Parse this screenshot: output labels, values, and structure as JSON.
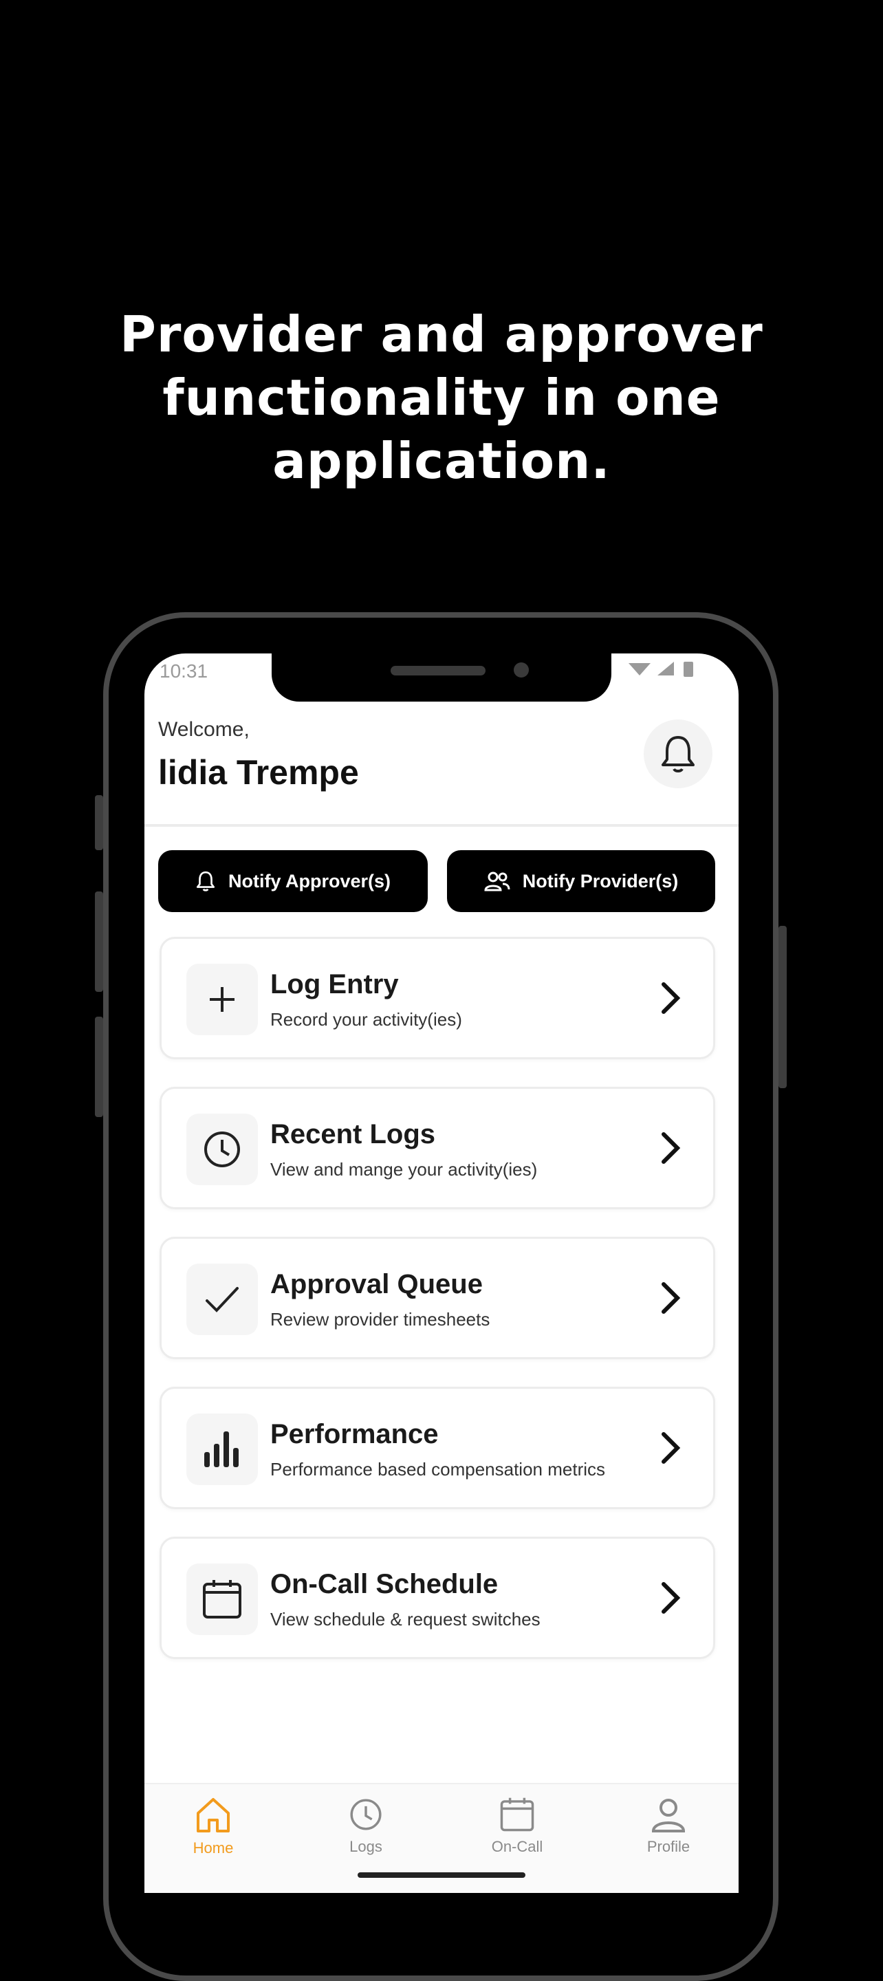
{
  "headline": {
    "line1": "Provider and approver",
    "line2": "functionality in one",
    "line3": "application."
  },
  "status_bar": {
    "time": "10:31",
    "icons": "▾◢▮"
  },
  "header": {
    "welcome": "Welcome,",
    "user_name": "lidia Trempe",
    "bell_icon": "bell-icon"
  },
  "actions": {
    "notify_approvers": "Notify Approver(s)",
    "notify_providers": "Notify Provider(s)"
  },
  "menu": [
    {
      "title": "Log Entry",
      "subtitle": "Record your activity(ies)",
      "icon": "plus-icon"
    },
    {
      "title": "Recent Logs",
      "subtitle": "View and mange your activity(ies)",
      "icon": "clock-icon"
    },
    {
      "title": "Approval Queue",
      "subtitle": "Review provider timesheets",
      "icon": "check-icon"
    },
    {
      "title": "Performance",
      "subtitle": "Performance based compensation metrics",
      "icon": "bar-chart-icon"
    },
    {
      "title": "On-Call Schedule",
      "subtitle": "View schedule & request switches",
      "icon": "calendar-icon"
    }
  ],
  "tabs": [
    {
      "label": "Home",
      "icon": "home-icon",
      "active": true
    },
    {
      "label": "Logs",
      "icon": "clock-icon",
      "active": false
    },
    {
      "label": "On-Call",
      "icon": "calendar-icon",
      "active": false
    },
    {
      "label": "Profile",
      "icon": "user-icon",
      "active": false
    }
  ],
  "colors": {
    "accent": "#f29b1d",
    "button_bg": "#000000",
    "background": "#000000"
  }
}
